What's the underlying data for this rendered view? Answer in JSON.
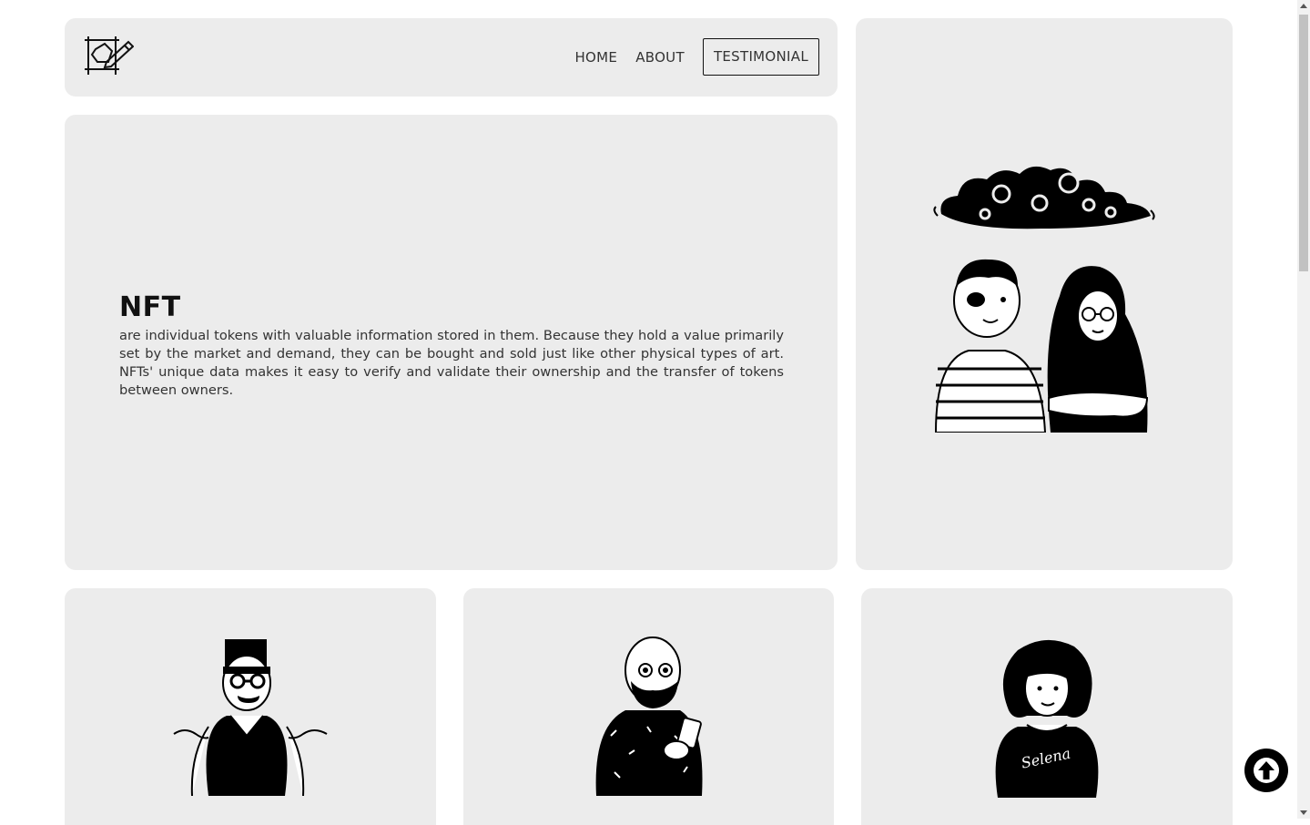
{
  "nav": {
    "logo_icon": "pencil-drafting-logo-icon",
    "items": [
      {
        "label": "HOME",
        "active": false
      },
      {
        "label": "ABOUT",
        "active": false
      },
      {
        "label": "TESTIMONIAL",
        "active": true
      }
    ]
  },
  "hero": {
    "title": "NFT",
    "body": "are individual tokens with valuable information stored in them. Because they hold a value primarily set by the market and demand, they can be bought and sold just like other physical types of art. NFTs' unique data makes it easy to verify and validate their ownership and the transfer of tokens between owners."
  },
  "side_illustration": "two-people-under-cloud-illustration",
  "people": [
    {
      "illustration": "shrugging-man-illustration"
    },
    {
      "illustration": "bald-man-with-phone-illustration"
    },
    {
      "illustration": "curly-hair-woman-illustration",
      "shirt_text": "Selena"
    }
  ],
  "scroll_top": {
    "icon": "arrow-up-icon"
  },
  "colors": {
    "card": "#ececec",
    "ink": "#000000",
    "background": "#ffffff"
  }
}
